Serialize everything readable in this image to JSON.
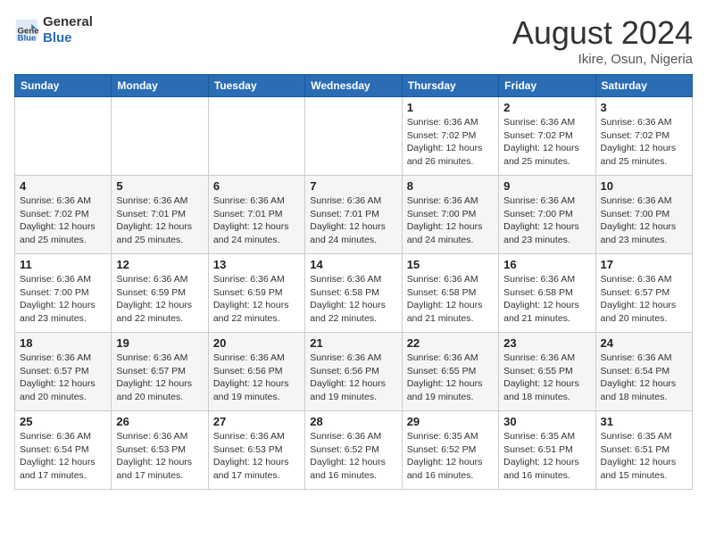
{
  "logo": {
    "line1": "General",
    "line2": "Blue"
  },
  "title": "August 2024",
  "subtitle": "Ikire, Osun, Nigeria",
  "days_of_week": [
    "Sunday",
    "Monday",
    "Tuesday",
    "Wednesday",
    "Thursday",
    "Friday",
    "Saturday"
  ],
  "weeks": [
    [
      {
        "day": "",
        "info": ""
      },
      {
        "day": "",
        "info": ""
      },
      {
        "day": "",
        "info": ""
      },
      {
        "day": "",
        "info": ""
      },
      {
        "day": "1",
        "info": "Sunrise: 6:36 AM\nSunset: 7:02 PM\nDaylight: 12 hours\nand 26 minutes."
      },
      {
        "day": "2",
        "info": "Sunrise: 6:36 AM\nSunset: 7:02 PM\nDaylight: 12 hours\nand 25 minutes."
      },
      {
        "day": "3",
        "info": "Sunrise: 6:36 AM\nSunset: 7:02 PM\nDaylight: 12 hours\nand 25 minutes."
      }
    ],
    [
      {
        "day": "4",
        "info": "Sunrise: 6:36 AM\nSunset: 7:02 PM\nDaylight: 12 hours\nand 25 minutes."
      },
      {
        "day": "5",
        "info": "Sunrise: 6:36 AM\nSunset: 7:01 PM\nDaylight: 12 hours\nand 25 minutes."
      },
      {
        "day": "6",
        "info": "Sunrise: 6:36 AM\nSunset: 7:01 PM\nDaylight: 12 hours\nand 24 minutes."
      },
      {
        "day": "7",
        "info": "Sunrise: 6:36 AM\nSunset: 7:01 PM\nDaylight: 12 hours\nand 24 minutes."
      },
      {
        "day": "8",
        "info": "Sunrise: 6:36 AM\nSunset: 7:00 PM\nDaylight: 12 hours\nand 24 minutes."
      },
      {
        "day": "9",
        "info": "Sunrise: 6:36 AM\nSunset: 7:00 PM\nDaylight: 12 hours\nand 23 minutes."
      },
      {
        "day": "10",
        "info": "Sunrise: 6:36 AM\nSunset: 7:00 PM\nDaylight: 12 hours\nand 23 minutes."
      }
    ],
    [
      {
        "day": "11",
        "info": "Sunrise: 6:36 AM\nSunset: 7:00 PM\nDaylight: 12 hours\nand 23 minutes."
      },
      {
        "day": "12",
        "info": "Sunrise: 6:36 AM\nSunset: 6:59 PM\nDaylight: 12 hours\nand 22 minutes."
      },
      {
        "day": "13",
        "info": "Sunrise: 6:36 AM\nSunset: 6:59 PM\nDaylight: 12 hours\nand 22 minutes."
      },
      {
        "day": "14",
        "info": "Sunrise: 6:36 AM\nSunset: 6:58 PM\nDaylight: 12 hours\nand 22 minutes."
      },
      {
        "day": "15",
        "info": "Sunrise: 6:36 AM\nSunset: 6:58 PM\nDaylight: 12 hours\nand 21 minutes."
      },
      {
        "day": "16",
        "info": "Sunrise: 6:36 AM\nSunset: 6:58 PM\nDaylight: 12 hours\nand 21 minutes."
      },
      {
        "day": "17",
        "info": "Sunrise: 6:36 AM\nSunset: 6:57 PM\nDaylight: 12 hours\nand 20 minutes."
      }
    ],
    [
      {
        "day": "18",
        "info": "Sunrise: 6:36 AM\nSunset: 6:57 PM\nDaylight: 12 hours\nand 20 minutes."
      },
      {
        "day": "19",
        "info": "Sunrise: 6:36 AM\nSunset: 6:57 PM\nDaylight: 12 hours\nand 20 minutes."
      },
      {
        "day": "20",
        "info": "Sunrise: 6:36 AM\nSunset: 6:56 PM\nDaylight: 12 hours\nand 19 minutes."
      },
      {
        "day": "21",
        "info": "Sunrise: 6:36 AM\nSunset: 6:56 PM\nDaylight: 12 hours\nand 19 minutes."
      },
      {
        "day": "22",
        "info": "Sunrise: 6:36 AM\nSunset: 6:55 PM\nDaylight: 12 hours\nand 19 minutes."
      },
      {
        "day": "23",
        "info": "Sunrise: 6:36 AM\nSunset: 6:55 PM\nDaylight: 12 hours\nand 18 minutes."
      },
      {
        "day": "24",
        "info": "Sunrise: 6:36 AM\nSunset: 6:54 PM\nDaylight: 12 hours\nand 18 minutes."
      }
    ],
    [
      {
        "day": "25",
        "info": "Sunrise: 6:36 AM\nSunset: 6:54 PM\nDaylight: 12 hours\nand 17 minutes."
      },
      {
        "day": "26",
        "info": "Sunrise: 6:36 AM\nSunset: 6:53 PM\nDaylight: 12 hours\nand 17 minutes."
      },
      {
        "day": "27",
        "info": "Sunrise: 6:36 AM\nSunset: 6:53 PM\nDaylight: 12 hours\nand 17 minutes."
      },
      {
        "day": "28",
        "info": "Sunrise: 6:36 AM\nSunset: 6:52 PM\nDaylight: 12 hours\nand 16 minutes."
      },
      {
        "day": "29",
        "info": "Sunrise: 6:35 AM\nSunset: 6:52 PM\nDaylight: 12 hours\nand 16 minutes."
      },
      {
        "day": "30",
        "info": "Sunrise: 6:35 AM\nSunset: 6:51 PM\nDaylight: 12 hours\nand 16 minutes."
      },
      {
        "day": "31",
        "info": "Sunrise: 6:35 AM\nSunset: 6:51 PM\nDaylight: 12 hours\nand 15 minutes."
      }
    ]
  ]
}
